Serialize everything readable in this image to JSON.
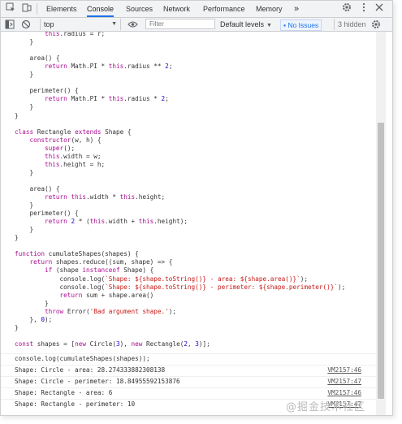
{
  "tabs": [
    "Elements",
    "Console",
    "Sources",
    "Network",
    "Performance",
    "Memory"
  ],
  "tabbar": {
    "more": "»"
  },
  "toolbar": {
    "context": "top",
    "filter_placeholder": "Filter",
    "levels": "Default levels",
    "issues": "No Issues",
    "hidden": "3 hidden"
  },
  "code_lines": [
    "        this.radius = r;",
    "    }",
    "",
    "    area() {",
    "        return Math.PI * this.radius ** 2;",
    "    }",
    "",
    "    perimeter() {",
    "        return Math.PI * this.radius * 2;",
    "    }",
    "}",
    "",
    "class Rectangle extends Shape {",
    "    constructor(w, h) {",
    "        super();",
    "        this.width = w;",
    "        this.height = h;",
    "    }",
    "",
    "    area() {",
    "        return this.width * this.height;",
    "    }",
    "    perimeter() {",
    "        return 2 * (this.width + this.height);",
    "    }",
    "}",
    "",
    "function cumulateShapes(shapes) {",
    "    return shapes.reduce((sum, shape) => {",
    "        if (shape instanceof Shape) {",
    "            console.log(`Shape: ${shape.toString()} - area: ${shape.area()}`);",
    "            console.log(`Shape: ${shape.toString()} - perimeter: ${shape.perimeter()}`);",
    "            return sum + shape.area()",
    "        }",
    "        throw Error('Bad argument shape.');",
    "    }, 0);",
    "}",
    "",
    "const shapes = [new Circle(3), new Rectangle(2, 3)];"
  ],
  "input_line": "console.log(cumulateShapes(shapes));",
  "logs": [
    {
      "msg": "Shape: Circle - area: 28.274333882308138",
      "src": "VM2157:46"
    },
    {
      "msg": "Shape: Circle - perimeter: 18.84955592153876",
      "src": "VM2157:47"
    },
    {
      "msg": "Shape: Rectangle - area: 6",
      "src": "VM2157:46"
    },
    {
      "msg": "Shape: Rectangle - perimeter: 10",
      "src": "VM2157:47"
    }
  ],
  "watermark": "@掘金技术社区"
}
